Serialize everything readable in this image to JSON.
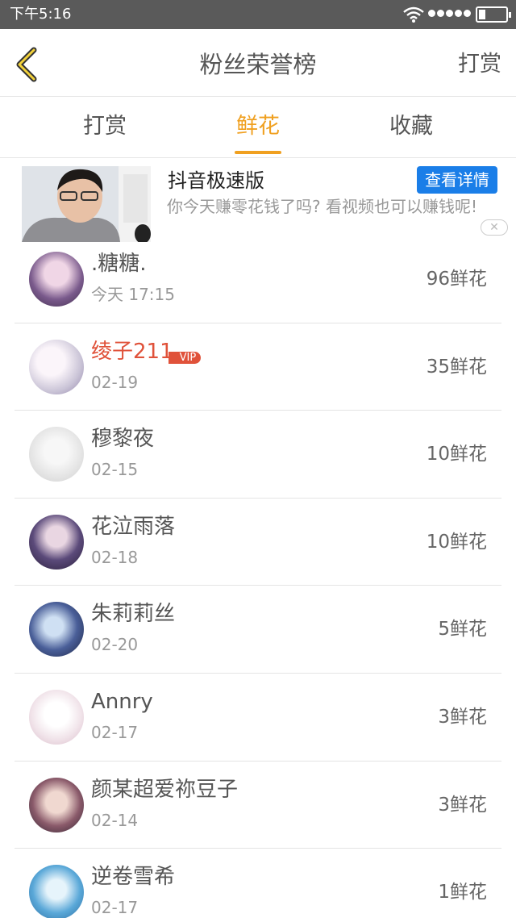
{
  "status_bar": {
    "time": "下午5:16"
  },
  "header": {
    "title": "粉丝荣誉榜",
    "right_action": "打赏"
  },
  "tabs": [
    {
      "label": "打赏",
      "active": false
    },
    {
      "label": "鲜花",
      "active": true
    },
    {
      "label": "收藏",
      "active": false
    }
  ],
  "ad": {
    "title": "抖音极速版",
    "button": "查看详情",
    "description": "你今天赚零花钱了吗? 看视频也可以赚钱呢!",
    "close_icon": "close-icon"
  },
  "ranking": [
    {
      "name": ".糖糖.",
      "date": "今天 17:15",
      "amount": "96鲜花",
      "vip": false,
      "avatar_color": "#7a5a8c"
    },
    {
      "name": "绫子211",
      "date": "02-19",
      "amount": "35鲜花",
      "vip": true,
      "vip_label": "VIP",
      "avatar_color": "#c9c3d6"
    },
    {
      "name": "穆黎夜",
      "date": "02-15",
      "amount": "10鲜花",
      "vip": false,
      "avatar_color": "#e3e3e3"
    },
    {
      "name": "花泣雨落",
      "date": "02-18",
      "amount": "10鲜花",
      "vip": false,
      "avatar_color": "#3a2b52"
    },
    {
      "name": "朱莉莉丝",
      "date": "02-20",
      "amount": "5鲜花",
      "vip": false,
      "avatar_color": "#2c3a66"
    },
    {
      "name": "Annry",
      "date": "02-17",
      "amount": "3鲜花",
      "vip": false,
      "avatar_color": "#f1e4ea"
    },
    {
      "name": "颜某超爱祢豆子",
      "date": "02-14",
      "amount": "3鲜花",
      "vip": false,
      "avatar_color": "#4b3a4a"
    },
    {
      "name": "逆卷雪希",
      "date": "02-17",
      "amount": "1鲜花",
      "vip": false,
      "avatar_color": "#5aa8d8"
    }
  ],
  "colors": {
    "accent": "#f0a020",
    "vip_name": "#e0523a",
    "ad_button": "#1a7ee8"
  }
}
